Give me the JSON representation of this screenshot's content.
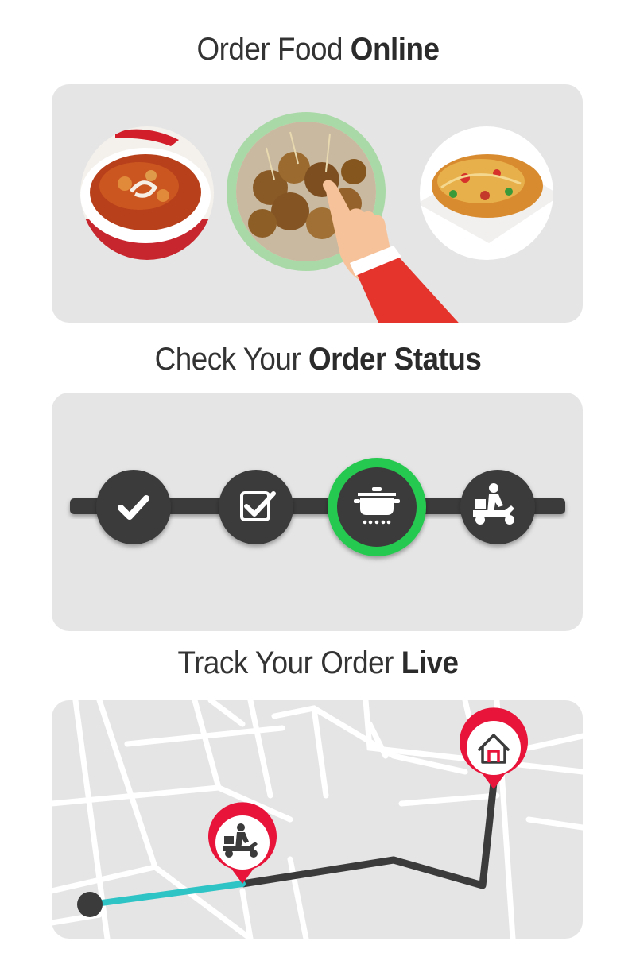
{
  "sections": {
    "online": {
      "title_plain": "Order Food ",
      "title_bold": "Online"
    },
    "status": {
      "title_plain": "Check Your ",
      "title_bold": "Order Status"
    },
    "live": {
      "title_plain": "Track Your Order ",
      "title_bold": "Live"
    }
  },
  "food_items": [
    {
      "icon": "curry-bowl"
    },
    {
      "icon": "pakora-plate",
      "selected": true
    },
    {
      "icon": "chaat-plate"
    }
  ],
  "status_steps": [
    {
      "icon": "checkmark-icon",
      "state": "done"
    },
    {
      "icon": "checkbox-icon",
      "state": "done"
    },
    {
      "icon": "cooking-pot-icon",
      "state": "current"
    },
    {
      "icon": "delivery-scooter-icon",
      "state": "pending"
    }
  ],
  "colors": {
    "card": "#e5e5e5",
    "dark": "#3b3b3b",
    "accent_green": "#27c94f",
    "pin_red": "#e8143a",
    "route_done": "#2ec4c6"
  }
}
